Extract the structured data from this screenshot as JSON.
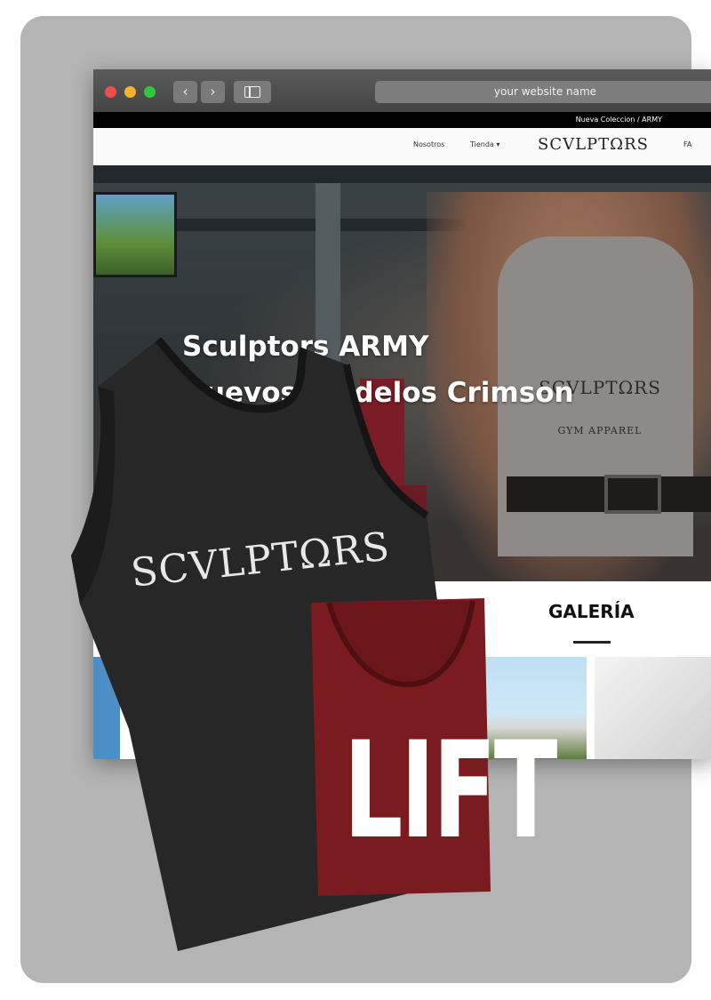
{
  "browser": {
    "address_text": "your website name",
    "back_label": "‹",
    "forward_label": "›"
  },
  "site": {
    "announcement": "Nueva Coleccion / ARMY",
    "nav": {
      "nosotros": "Nosotros",
      "tienda": "Tienda ▾",
      "logo": "SCVLPTΩRS",
      "more": "FA"
    },
    "hero": {
      "line1": "Sculptors ARMY",
      "line2": "Nuevos modelos Crimson",
      "model_shirt_logo": "SCVLPTΩRS",
      "model_shirt_sub": "GYM APPAREL"
    },
    "gallery": {
      "title": "GALERÍA"
    }
  },
  "products": {
    "black_tank_print": "SCVLPTΩRS",
    "red_tee_print": "LIFT"
  },
  "colors": {
    "card_background": "#b5b4b4",
    "red_shirt": "#7a1b1f",
    "black_shirt": "#262626"
  }
}
